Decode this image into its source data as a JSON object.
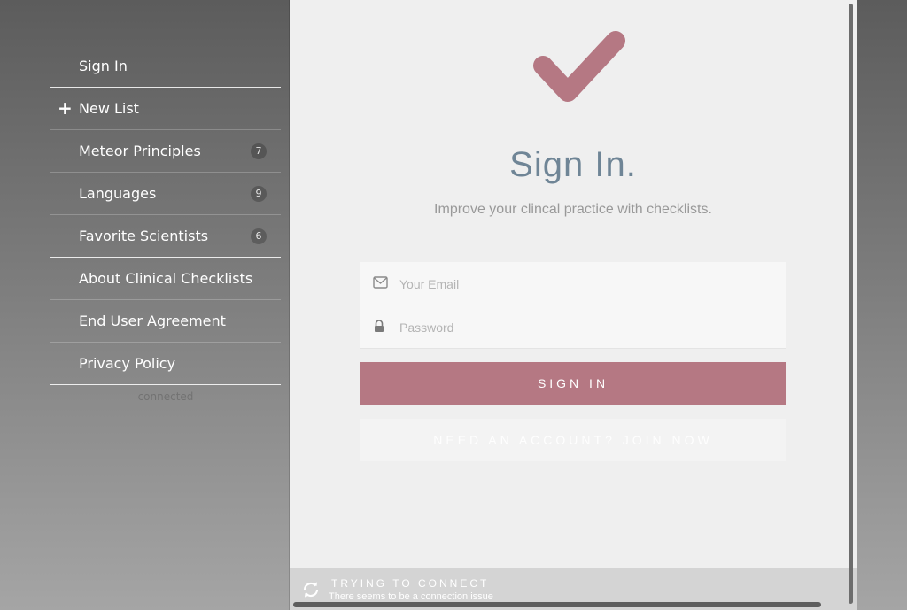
{
  "sidebar": {
    "items": [
      {
        "label": "Sign In"
      },
      {
        "label": "New List",
        "icon": "plus-icon"
      },
      {
        "label": "Meteor Principles",
        "count": "7"
      },
      {
        "label": "Languages",
        "count": "9"
      },
      {
        "label": "Favorite Scientists",
        "count": "6"
      },
      {
        "label": "About Clinical Checklists"
      },
      {
        "label": "End User Agreement"
      },
      {
        "label": "Privacy Policy"
      }
    ],
    "connection_note": "connected"
  },
  "main": {
    "logo_icon": "checkmark-icon",
    "title": "Sign In.",
    "subtitle": "Improve your clincal practice with checklists.",
    "email": {
      "placeholder": "Your Email",
      "value": "",
      "icon": "envelope-icon"
    },
    "password": {
      "placeholder": "Password",
      "value": "",
      "icon": "lock-icon"
    },
    "signin_label": "Sign In",
    "join_label": "Need an account? Join Now"
  },
  "connection": {
    "icon": "sync-icon",
    "title": "TRYING TO CONNECT",
    "subtitle": "There seems to be a connection issue"
  },
  "colors": {
    "accent": "#b57883",
    "title": "#6f8596",
    "panel": "#efefef"
  }
}
